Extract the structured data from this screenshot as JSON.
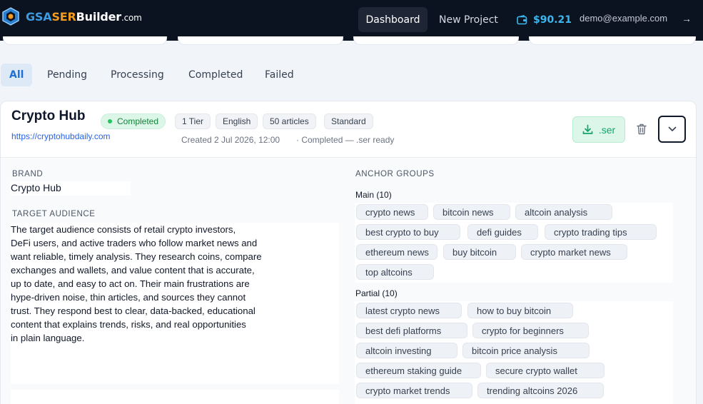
{
  "brand": {
    "gsa": "GSA",
    "ser": "SER",
    "builder": "Builder",
    "com": ".com"
  },
  "nav": {
    "dashboard": "Dashboard",
    "new_project": "New Project",
    "balance": "$90.21",
    "email": "demo@example.com",
    "logout_glyph": "→"
  },
  "tabs": [
    {
      "label": "All",
      "active": true
    },
    {
      "label": "Pending"
    },
    {
      "label": "Processing"
    },
    {
      "label": "Completed"
    },
    {
      "label": "Failed"
    }
  ],
  "project": {
    "name": "Crypto Hub",
    "url": "https://cryptohubdaily.com",
    "status": "Completed",
    "tier": "1 Tier",
    "language": "English",
    "articles": "50 articles",
    "plan": "Standard",
    "created": "Created 2 Jul 2026, 12:00",
    "completed_note": "· Completed — .ser ready",
    "download_label": ".ser",
    "brand_label": "BRAND",
    "brand_value": "Crypto Hub",
    "audience_label": "TARGET AUDIENCE",
    "audience_lines": [
      "The target audience consists of retail crypto investors,",
      "DeFi users, and active traders who follow market news and",
      "want reliable, timely analysis. They research coins, compare",
      "exchanges and wallets, and value content that is accurate,",
      "up to date, and easy to act on. Their main frustrations are",
      "hype-driven noise, thin articles, and sources they cannot",
      "trust. They respond best to clear, data-backed, educational",
      "content that explains trends, risks, and real opportunities",
      "in plain language."
    ],
    "anchor_label": "ANCHOR GROUPS",
    "main_group": {
      "title": "Main (10)",
      "anchors": [
        "crypto news",
        "bitcoin news",
        "altcoin analysis",
        "best crypto to buy",
        "defi guides",
        "crypto trading tips",
        "ethereum news",
        "buy bitcoin",
        "crypto market news",
        "top altcoins"
      ]
    },
    "partial_group": {
      "title": "Partial (10)",
      "anchors": [
        "latest crypto news",
        "how to buy bitcoin",
        "best defi platforms",
        "crypto for beginners",
        "altcoin investing",
        "bitcoin price analysis",
        "ethereum staking guide",
        "secure crypto wallet",
        "crypto market trends",
        "trending altcoins 2026"
      ]
    }
  },
  "colors": {
    "topbar": "#0b1220",
    "accent": "#1d6fd6",
    "success": "#14a36b",
    "wallet": "#39b7f0"
  }
}
